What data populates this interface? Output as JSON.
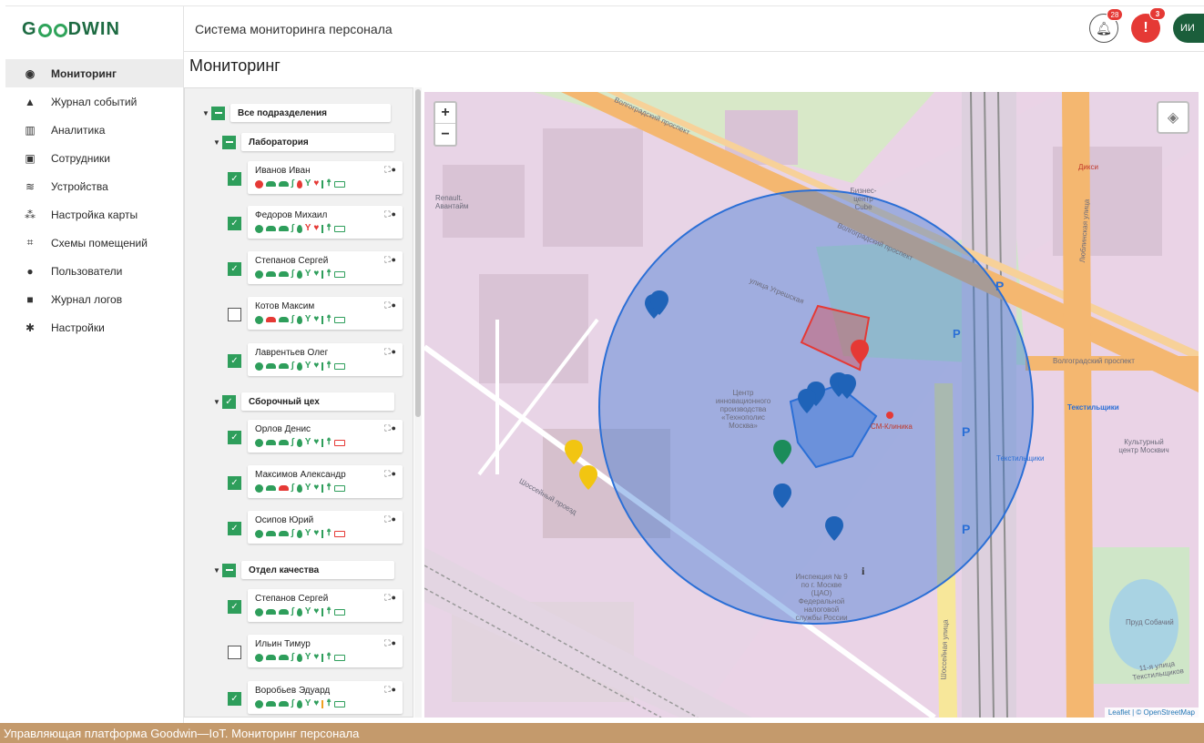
{
  "app": {
    "logo": "GOODWIN",
    "header_title": "Система мониторинга персонала",
    "notifications_count": "28",
    "alerts_count": "3",
    "avatar_initials": "ИИ",
    "page_title": "Мониторинг"
  },
  "sidebar": {
    "items": [
      {
        "label": "Мониторинг",
        "icon": "eye-icon",
        "active": true
      },
      {
        "label": "Журнал событий",
        "icon": "bell-icon"
      },
      {
        "label": "Аналитика",
        "icon": "chart-icon"
      },
      {
        "label": "Сотрудники",
        "icon": "id-card-icon"
      },
      {
        "label": "Устройства",
        "icon": "wifi-icon"
      },
      {
        "label": "Настройка карты",
        "icon": "map-settings-icon"
      },
      {
        "label": "Схемы помещений",
        "icon": "floorplan-icon"
      },
      {
        "label": "Пользователи",
        "icon": "users-icon"
      },
      {
        "label": "Журнал логов",
        "icon": "log-icon"
      },
      {
        "label": "Настройки",
        "icon": "gear-icon"
      }
    ]
  },
  "tree": {
    "root": "Все подразделения",
    "groups": [
      {
        "label": "Лаборатория",
        "state": "partial"
      },
      {
        "label": "Сборочный цех",
        "state": "checked"
      },
      {
        "label": "Отдел качества",
        "state": "partial"
      }
    ],
    "people": [
      {
        "name": "Иванов Иван",
        "checked": true
      },
      {
        "name": "Федоров Михаил",
        "checked": true
      },
      {
        "name": "Степанов Сергей",
        "checked": true
      },
      {
        "name": "Котов Максим",
        "checked": false
      },
      {
        "name": "Лаврентьев Олег",
        "checked": true
      },
      {
        "name": "Орлов Денис",
        "checked": true
      },
      {
        "name": "Максимов Александр",
        "checked": true
      },
      {
        "name": "Осипов Юрий",
        "checked": true
      },
      {
        "name": "Степанов Сергей",
        "checked": true
      },
      {
        "name": "Ильин Тимур",
        "checked": false
      },
      {
        "name": "Воробьев Эдуард",
        "checked": true
      }
    ]
  },
  "map": {
    "zoom_in": "+",
    "zoom_out": "−",
    "labels": {
      "road1": "Волгоградский проспект",
      "road2": "Волгоградский проспект",
      "road3": "Волгоградский проспект",
      "street1": "улица Угрешская",
      "street2": "Шоссейный проезд",
      "renault": "Renault. Авантайм",
      "business": "Бизнес-центр Cube",
      "techno": "Центр инновационного производства «Технополис Москва»",
      "clinic": "СМ-Клиника",
      "inspection": "Инспекция № 9 по г. Москве (ЦАО) Федеральной налоговой службы России",
      "station": "Текстильщики",
      "station2": "Текстильщики",
      "culture": "Культурный центр Москвич",
      "lyublinskaya": "Люблинская улица",
      "street11": "11-я улица Текстильщиков",
      "shosseyny": "Шоссейная улица",
      "pond": "Пруд Собачий",
      "dixi": "Дикси"
    },
    "attribution": "Leaflet | © OpenStreetMap",
    "colors": {
      "zone": "#2b6fd6",
      "restricted": "#e53935",
      "pin_blue": "#1f63b8",
      "pin_green": "#1b8c5a",
      "pin_yellow": "#f2c511"
    }
  },
  "caption": "Управляющая платформа Goodwin—IoT. Мониторинг персонала"
}
